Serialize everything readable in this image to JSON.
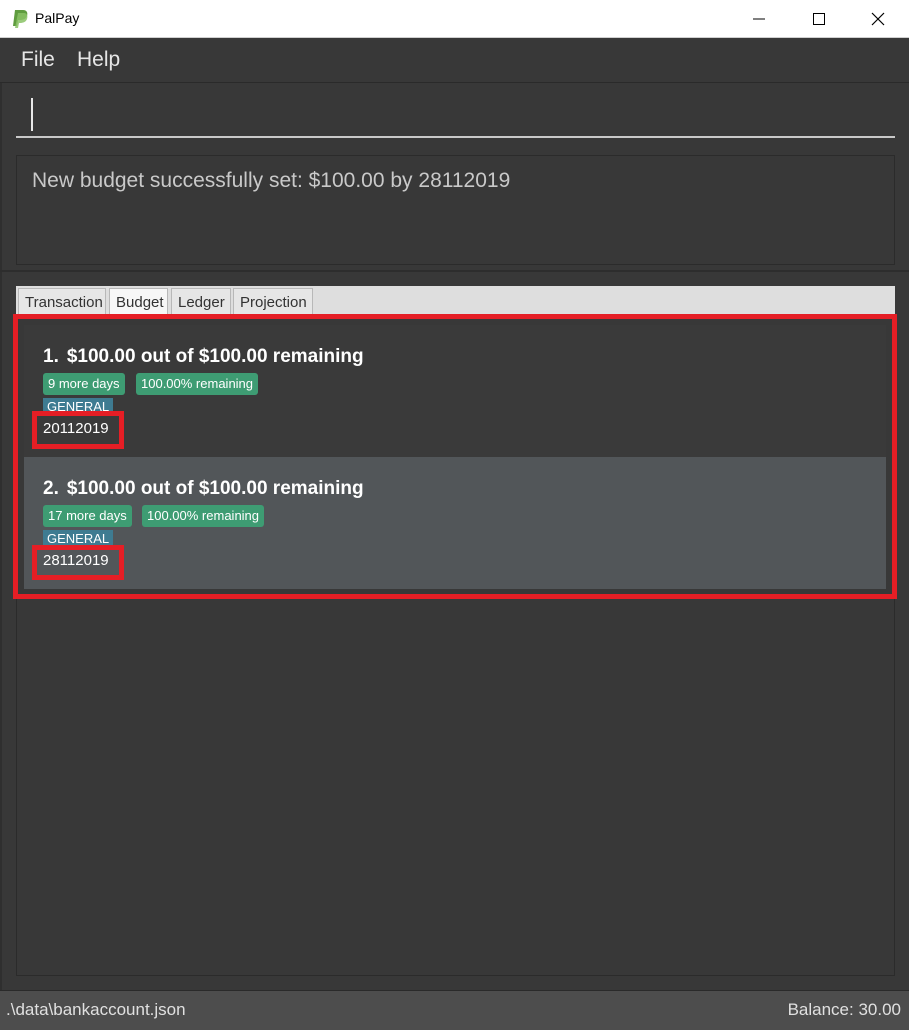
{
  "window": {
    "title": "PalPay",
    "accent_color": "#6aa84f",
    "controls": [
      "minimize-icon",
      "maximize-icon",
      "close-icon"
    ]
  },
  "menu": {
    "file": "File",
    "help": "Help"
  },
  "command": {
    "value": "",
    "placeholder": ""
  },
  "result": {
    "message": "New budget successfully set: $100.00 by 28112019"
  },
  "tabs": [
    {
      "label": "Transaction",
      "active": false
    },
    {
      "label": "Budget",
      "active": true
    },
    {
      "label": "Ledger",
      "active": false
    },
    {
      "label": "Projection",
      "active": false
    }
  ],
  "budgets": [
    {
      "index": "1.",
      "summary": "$100.00 out of $100.00 remaining",
      "days_tag": "9 more days",
      "percent_tag": "100.00% remaining",
      "category": "GENERAL",
      "date": "20112019"
    },
    {
      "index": "2.",
      "summary": "$100.00 out of $100.00 remaining",
      "days_tag": "17 more days",
      "percent_tag": "100.00% remaining",
      "category": "GENERAL",
      "date": "28112019"
    }
  ],
  "status": {
    "path": ".\\data\\bankaccount.json",
    "balance": "Balance: 30.00"
  },
  "colors": {
    "background": "#383838",
    "highlight": "#e51e25",
    "tag_green": "#3e9c73",
    "tag_blue": "#3e7b91",
    "selected_card": "#525659"
  }
}
